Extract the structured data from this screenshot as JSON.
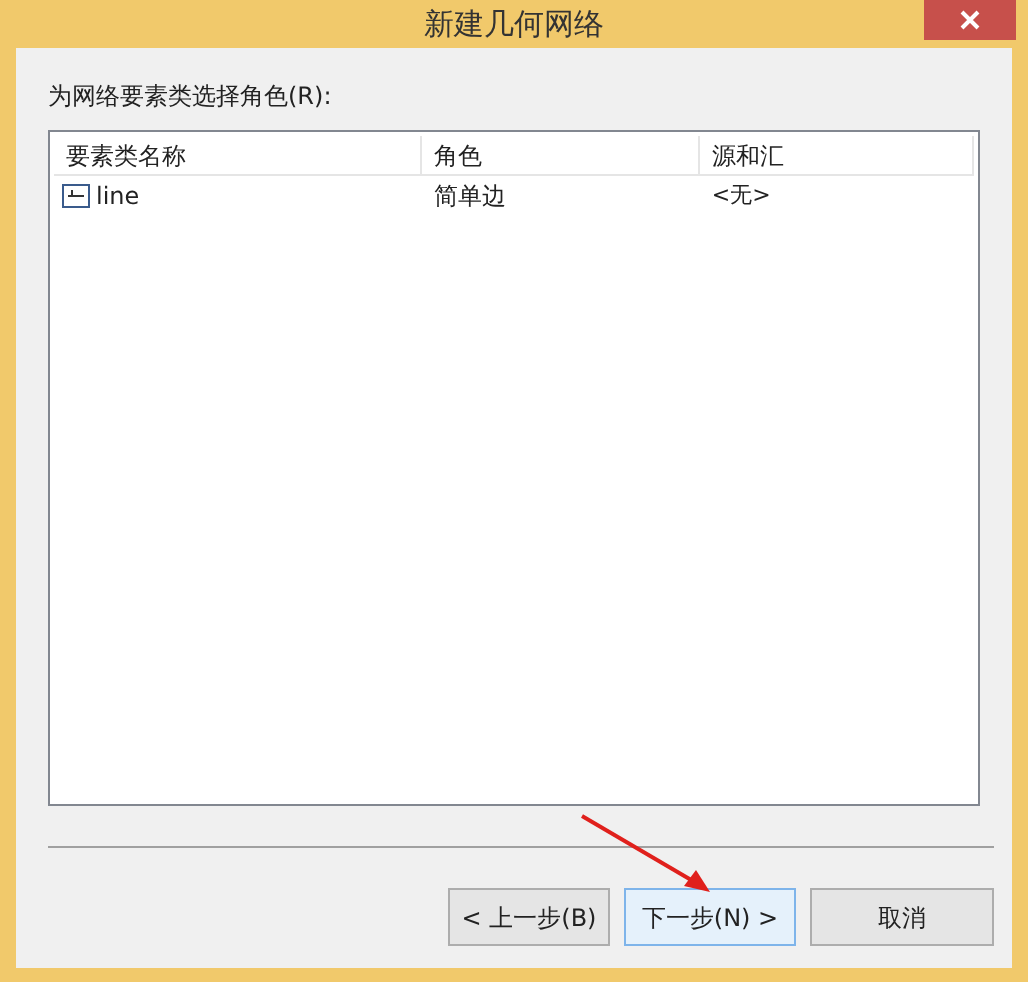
{
  "window": {
    "title": "新建几何网络"
  },
  "prompt": "为网络要素类选择角色(R):",
  "table": {
    "columns": [
      "要素类名称",
      "角色",
      "源和汇"
    ],
    "rows": [
      {
        "cells": [
          "line",
          "简单边",
          "<无>"
        ]
      }
    ]
  },
  "buttons": [
    {
      "label": "< 上一步(B)",
      "highlighted": false
    },
    {
      "label": "下一步(N) >",
      "highlighted": true
    },
    {
      "label": "取消",
      "highlighted": false
    }
  ]
}
